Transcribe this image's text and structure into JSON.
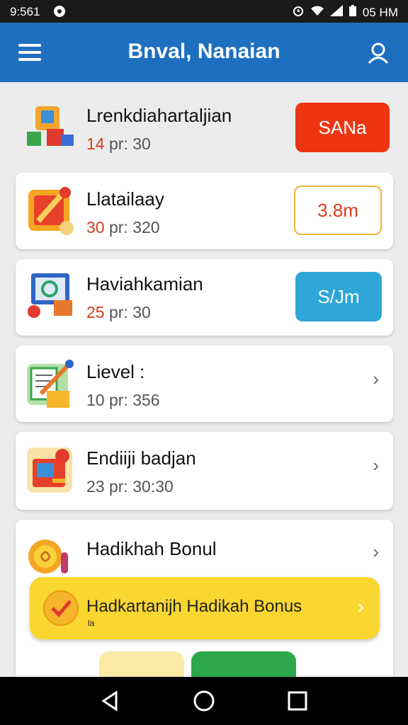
{
  "status_bar": {
    "time": "9:561",
    "right_text": "05 HM"
  },
  "app_bar": {
    "title": "Bnval, Nanaian"
  },
  "items": [
    {
      "title": "Lrenkdiahartaljian",
      "num": "14",
      "sub": "pr: 30",
      "action": "SANa",
      "action_style": "red"
    },
    {
      "title": "Llatailaay",
      "num": "30",
      "sub": "pr: 320",
      "action": "3.8m",
      "action_style": "outline"
    },
    {
      "title": "Haviahkamian",
      "num": "25",
      "sub": "pr: 30",
      "action": "S/Jm",
      "action_style": "blue"
    },
    {
      "title": "Lievel :",
      "num": "10",
      "sub": "pr: 356",
      "action": ""
    },
    {
      "title": "Endiiji badjan",
      "num": "23",
      "sub": "pr: 30:30",
      "action": ""
    },
    {
      "title": "Hadikhah Bonul",
      "num": "",
      "sub": "",
      "action": ""
    }
  ],
  "bonus_banner": {
    "text": "Hadkartanijh Hadikah Bonus",
    "small": "la"
  },
  "colors": {
    "app_bar": "#1f6fc0",
    "red_button": "#ee3512",
    "blue_button": "#2ea6d8",
    "bonus": "#f9d630"
  }
}
